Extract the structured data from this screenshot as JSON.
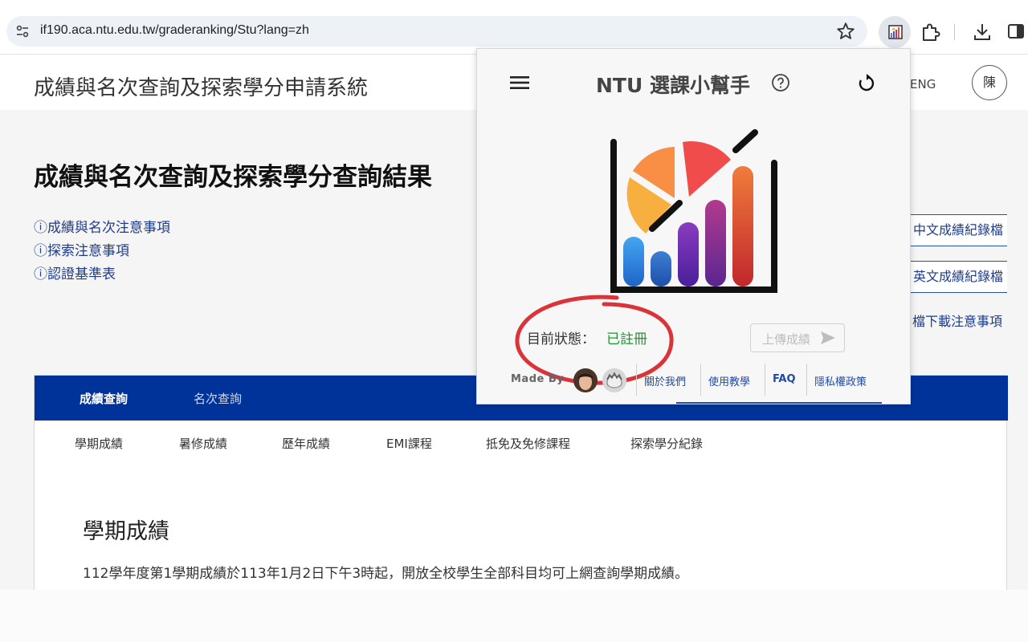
{
  "browser": {
    "url": "if190.aca.ntu.edu.tw/graderanking/Stu?lang=zh",
    "icons": [
      "site-info-icon",
      "star-icon",
      "extension-icon",
      "puzzle-icon",
      "download-icon",
      "sidepanel-icon"
    ]
  },
  "header": {
    "site_title": "成績與名次查詢及探索學分申請系統",
    "lang_toggle": "ENG",
    "user_avatar": "陳"
  },
  "main": {
    "page_title": "成績與名次查詢及探索學分查詢結果",
    "info_links": [
      "ⓘ成績與名次注意事項",
      "ⓘ探索注意事項",
      "ⓘ認證基準表"
    ],
    "right_buttons": [
      "中文成績紀錄檔",
      "英文成績紀錄檔"
    ],
    "right_text_link": "檔下載注意事項",
    "tabs": [
      {
        "label": "成績查詢",
        "active": true
      },
      {
        "label": "名次查詢",
        "active": false
      }
    ],
    "subtabs": [
      "學期成績",
      "暑修成績",
      "歷年成績",
      "EMI課程",
      "抵免及免修課程",
      "探索學分紀錄"
    ],
    "section_title": "學期成績",
    "section_text": "112學年度第1學期成績於113年1月2日下午3時起，開放全校學生全部科目均可上網查詢學期成績。"
  },
  "popup": {
    "title": "NTU 選課小幫手",
    "status_label": "目前狀態：",
    "status_value": "已註冊",
    "upload_button": "上傳成績",
    "made_by": "Made By",
    "footer_links": [
      "關於我們",
      "使用教學",
      "FAQ",
      "隱私權政策"
    ]
  },
  "colors": {
    "nav_blue": "#003399",
    "link_blue": "#1f3c8a",
    "status_green": "#1a9b2b",
    "annotation_red": "#d9343a"
  }
}
